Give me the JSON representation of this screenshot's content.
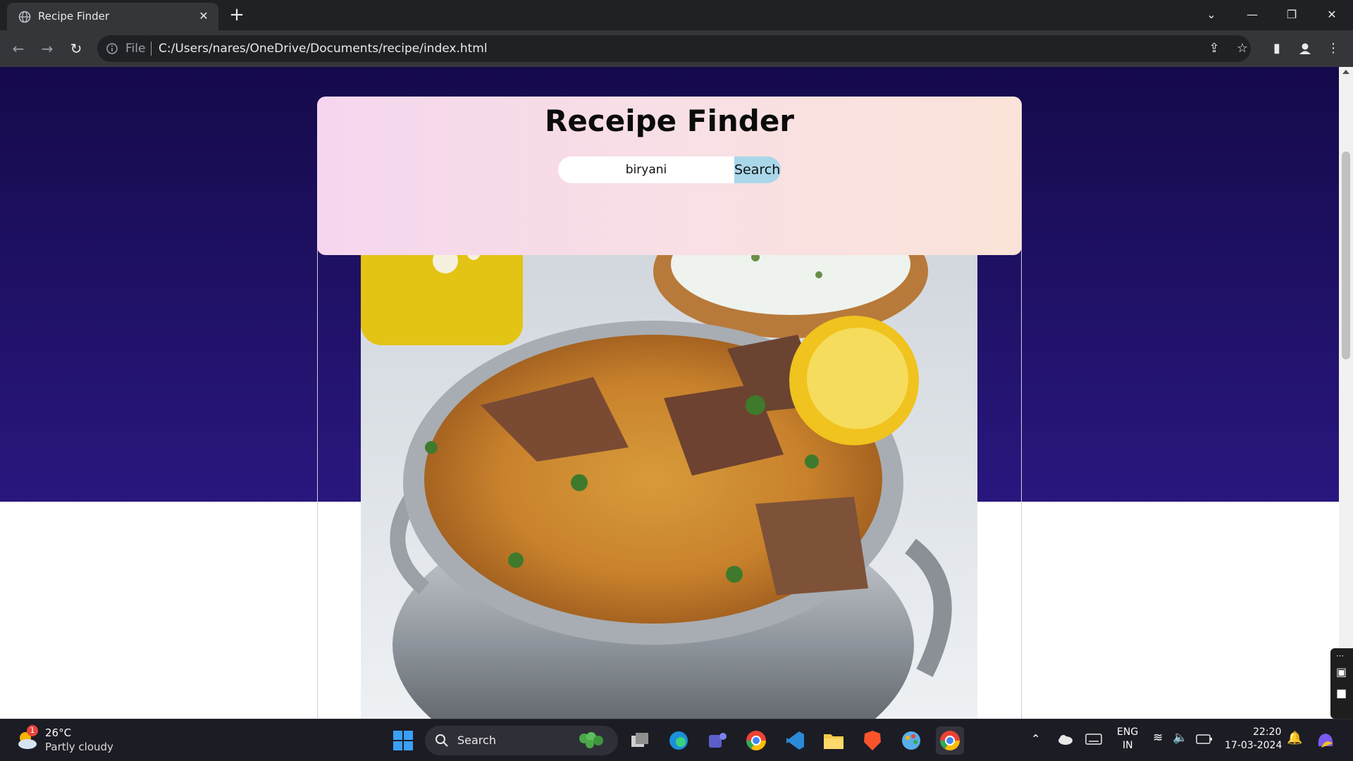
{
  "browser": {
    "tab_title": "Recipe Finder",
    "address_scheme": "File",
    "address_url": "C:/Users/nares/OneDrive/Documents/recipe/index.html"
  },
  "app": {
    "title": "Receipe Finder",
    "search": {
      "value": "biryani",
      "button_label": "Search"
    },
    "result_image": "biryani-in-handi-photo"
  },
  "taskbar": {
    "weather": {
      "badge": "1",
      "temperature": "26°C",
      "condition": "Partly cloudy"
    },
    "search_label": "Search",
    "language_line1": "ENG",
    "language_line2": "IN",
    "time": "22:20",
    "date": "17-03-2024"
  },
  "colors": {
    "hero_top": "#150a4b",
    "hero_bottom": "#2a177f",
    "search_button": "#a9d7ea"
  }
}
